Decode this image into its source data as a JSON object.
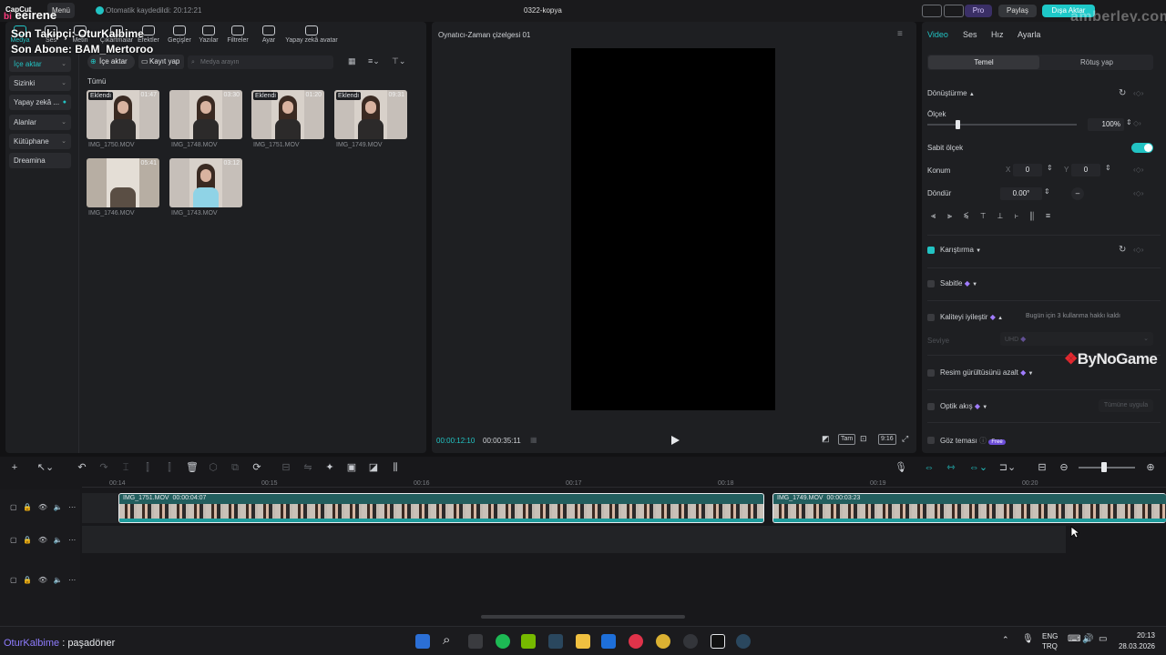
{
  "titlebar": {
    "app": "CapCut",
    "menu": "Menü",
    "autosave": "Otomatik kaydedildi: 20:12:21",
    "project": "0322-kopya",
    "pro": "Pro",
    "share": "Paylaş",
    "export": "Dışa Aktar",
    "watermark_url": "amberley.com.tr",
    "accent": "#22c3c3"
  },
  "overlay": {
    "brand_prefix": "bi",
    "brand": "eeirene",
    "follower": "Son Takipçi: OturKalbime",
    "subscriber": "Son Abone: BAM_Mertoroo",
    "logo": "ByNoGame",
    "ticker_name": "OturKalbime",
    "ticker_sep": " : ",
    "ticker_msg": "paşadöner"
  },
  "toolbar": {
    "tabs": [
      "Medya",
      "Ses",
      "Metin",
      "Çıkartmalar",
      "Efektler",
      "Geçişler",
      "Yazılar",
      "Filtreler",
      "Ayar",
      "Yapay zekâ avatar"
    ]
  },
  "media": {
    "sidebar": [
      "İçe aktar",
      "Sizinki",
      "Yapay zekâ ...",
      "Alanlar",
      "Kütüphane",
      "Dreamina"
    ],
    "import_btn": "İçe aktar",
    "record_btn": "Kayıt yap",
    "search_placeholder": "Medya arayın",
    "all_label": "Tümü",
    "items": [
      {
        "name": "IMG_1750.MOV",
        "dur": "01:47",
        "badge": "Eklendi"
      },
      {
        "name": "IMG_1748.MOV",
        "dur": "03:30",
        "badge": ""
      },
      {
        "name": "IMG_1751.MOV",
        "dur": "01:20",
        "badge": "Eklendi"
      },
      {
        "name": "IMG_1749.MOV",
        "dur": "09:31",
        "badge": "Eklendi"
      },
      {
        "name": "IMG_1746.MOV",
        "dur": "05:41",
        "badge": ""
      },
      {
        "name": "IMG_1743.MOV",
        "dur": "03:12",
        "badge": ""
      }
    ]
  },
  "preview": {
    "title": "Oynatıcı-Zaman çizelgesi 01",
    "current": "00:00:12:10",
    "total": "00:00:35:11",
    "full_btn": "Tam",
    "ratio_btn": "9:16"
  },
  "inspector": {
    "tabs": [
      "Video",
      "Ses",
      "Hız",
      "Ayarla"
    ],
    "seg": [
      "Temel",
      "Rötuş yap"
    ],
    "transform": "Dönüştürme",
    "scale_label": "Ölçek",
    "scale_val": "100%",
    "scale_fraction": 0.0,
    "fixed_scale": "Sabit ölçek",
    "position_label": "Konum",
    "x_label": "X",
    "x_val": "0",
    "y_label": "Y",
    "y_val": "0",
    "rotate_label": "Döndür",
    "rotate_val": "0.00°",
    "rotate_dash": "–",
    "blend": "Karıştırma",
    "stabilize": "Sabitle",
    "enhance": "Kaliteyi iyileştir",
    "enhance_note": "Bugün için 3 kullanma hakkı kaldı",
    "level_label": "Seviye",
    "level_val": "UHD",
    "denoise": "Resim gürültüsünü azalt",
    "optical": "Optik akış",
    "optical_note": "Tümüne uygula",
    "eye": "Göz teması",
    "free": "Free"
  },
  "timeline": {
    "ticks": [
      "00:14",
      "00:15",
      "00:16",
      "00:17",
      "00:18",
      "00:19",
      "00:20"
    ],
    "clip1_name": "IMG_1751.MOV",
    "clip1_dur": "00:00:04:07",
    "clip2_name": "IMG_1749.MOV",
    "clip2_dur": "00:00:03:23"
  },
  "taskbar": {
    "lang1": "ENG",
    "lang2": "TRQ",
    "time": "20:13",
    "date": "28.03.2026"
  }
}
